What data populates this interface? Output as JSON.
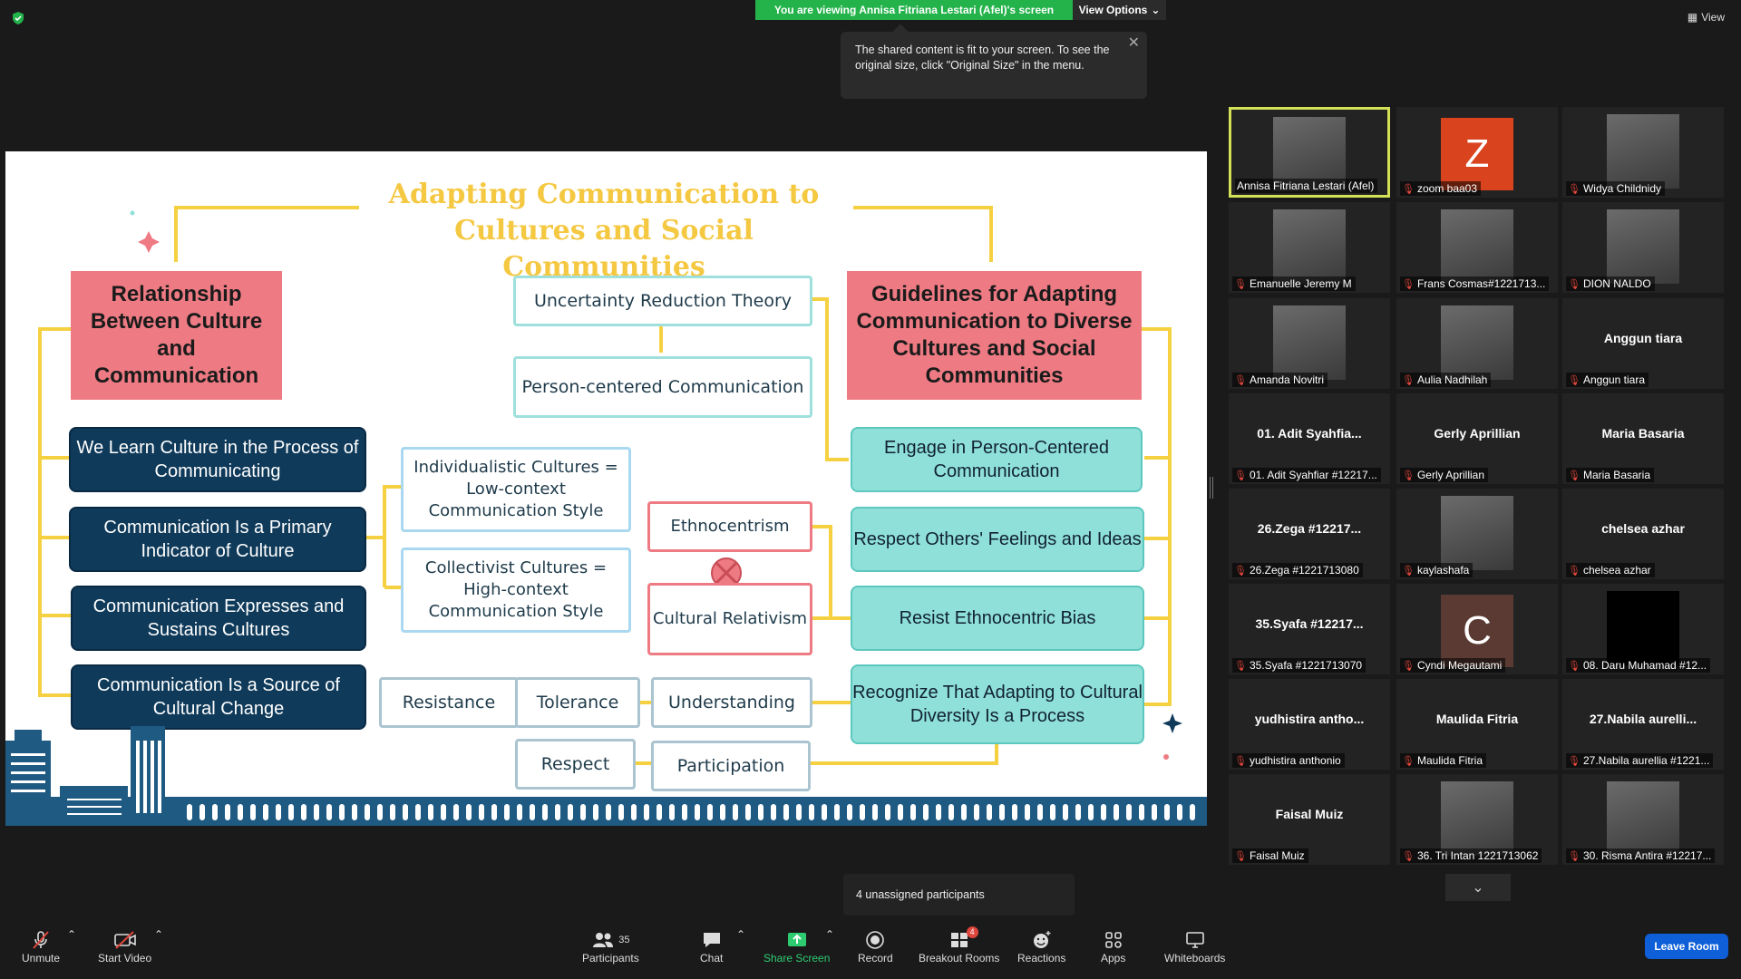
{
  "top": {
    "viewing_banner": "You are viewing Annisa Fitriana Lestari (Afel)'s screen",
    "view_options": "View Options",
    "tooltip": "The shared content is fit to your screen. To see the original size, click \"Original Size\" in the menu.",
    "view_label": "View"
  },
  "slide": {
    "title": "Adapting Communication to Cultures and Social Communities",
    "left_header": "Relationship Between Culture and Communication",
    "right_header": "Guidelines for Adapting Communication to Diverse Cultures and Social Communities",
    "left_items": [
      "We Learn Culture in the Process of Communicating",
      "Communication Is a Primary Indicator of Culture",
      "Communication Expresses and Sustains Cultures",
      "Communication Is a Source of Cultural Change"
    ],
    "right_items": [
      "Engage in Person-Centered Communication",
      "Respect Others' Feelings and Ideas",
      "Resist Ethnocentric Bias",
      "Recognize That Adapting to Cultural Diversity Is a Process"
    ],
    "urt": "Uncertainty Reduction Theory",
    "pcc": "Person-centered Communication",
    "individualistic": "Individualistic Cultures = Low-context Communication Style",
    "collectivist": "Collectivist Cultures = High-context Communication Style",
    "ethnocentrism": "Ethnocentrism",
    "relativism": "Cultural Relativism",
    "stages": [
      "Resistance",
      "Tolerance",
      "Understanding",
      "Respect",
      "Participation"
    ],
    "colors": {
      "title": "#f5c842",
      "pink": "#ee7b83",
      "navy": "#0f3a5a",
      "teal": "#8fe0d8",
      "connector": "#f5d142"
    }
  },
  "participants": [
    {
      "display": "",
      "label": "Annisa Fitriana Lestari (Afel)",
      "kind": "video",
      "muted": false,
      "active": true
    },
    {
      "display": "Z",
      "label": "zoom baa03",
      "kind": "avatar",
      "avatar_color": "#d9431e",
      "muted": true
    },
    {
      "display": "",
      "label": "Widya Childnidy",
      "kind": "video",
      "muted": true
    },
    {
      "display": "",
      "label": "Emanuelle Jeremy M",
      "kind": "video",
      "muted": true
    },
    {
      "display": "",
      "label": "Frans Cosmas#1221713...",
      "kind": "video",
      "muted": true
    },
    {
      "display": "",
      "label": "DION NALDO",
      "kind": "video",
      "muted": true
    },
    {
      "display": "",
      "label": "Amanda Novitri",
      "kind": "video",
      "muted": true
    },
    {
      "display": "",
      "label": "Aulia Nadhilah",
      "kind": "video",
      "muted": true
    },
    {
      "display": "Anggun tiara",
      "label": "Anggun tiara",
      "kind": "name",
      "muted": true
    },
    {
      "display": "01. Adit Syahfia...",
      "label": "01. Adit Syahfiar #12217...",
      "kind": "name",
      "muted": true
    },
    {
      "display": "Gerly Aprillian",
      "label": "Gerly Aprillian",
      "kind": "name",
      "muted": true
    },
    {
      "display": "Maria Basaria",
      "label": "Maria Basaria",
      "kind": "name",
      "muted": true
    },
    {
      "display": "26.Zega #12217...",
      "label": "26.Zega #1221713080",
      "kind": "name",
      "muted": true
    },
    {
      "display": "",
      "label": "kaylashafa",
      "kind": "video",
      "muted": true
    },
    {
      "display": "chelsea azhar",
      "label": "chelsea azhar",
      "kind": "name",
      "muted": true
    },
    {
      "display": "35.Syafa #12217...",
      "label": "35.Syafa #1221713070",
      "kind": "name",
      "muted": true
    },
    {
      "display": "C",
      "label": "Cyndi Megautami",
      "kind": "avatar",
      "avatar_color": "#5a3a32",
      "muted": true
    },
    {
      "display": "",
      "label": "08. Daru Muhamad #12...",
      "kind": "black",
      "muted": true
    },
    {
      "display": "yudhistira antho...",
      "label": "yudhistira anthonio",
      "kind": "name",
      "muted": true
    },
    {
      "display": "Maulida Fitria",
      "label": "Maulida Fitria",
      "kind": "name",
      "muted": true
    },
    {
      "display": "27.Nabila aurelli...",
      "label": "27.Nabila aurellia #1221...",
      "kind": "name",
      "muted": true
    },
    {
      "display": "Faisal Muiz",
      "label": "Faisal Muiz",
      "kind": "name",
      "muted": true
    },
    {
      "display": "",
      "label": "36. Tri Intan 1221713062",
      "kind": "video",
      "muted": true
    },
    {
      "display": "",
      "label": "30. Risma Antira #12217...",
      "kind": "video",
      "muted": true
    }
  ],
  "unassigned": "4 unassigned participants",
  "toolbar": {
    "unmute": "Unmute",
    "start_video": "Start Video",
    "participants": "Participants",
    "participants_count": "35",
    "chat": "Chat",
    "share_screen": "Share Screen",
    "record": "Record",
    "breakout": "Breakout Rooms",
    "breakout_badge": "4",
    "reactions": "Reactions",
    "apps": "Apps",
    "whiteboards": "Whiteboards",
    "leave": "Leave Room"
  }
}
